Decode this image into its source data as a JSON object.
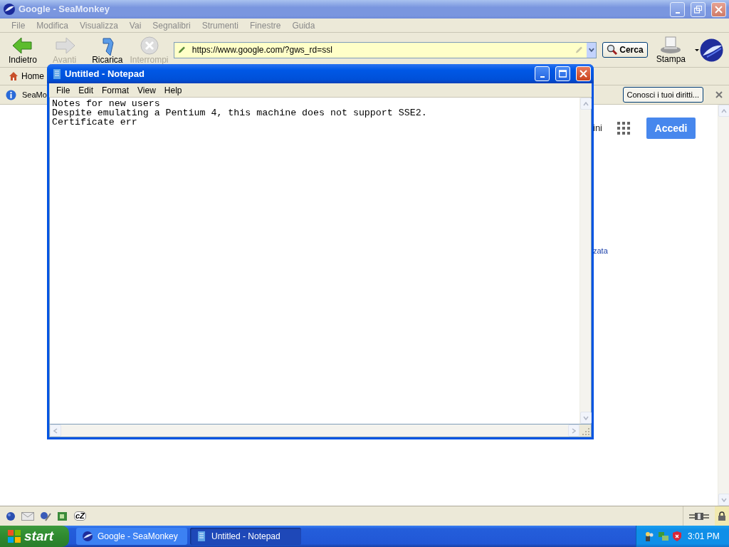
{
  "browser": {
    "title": "Google - SeaMonkey",
    "active": false,
    "menu": [
      "File",
      "Modifica",
      "Visualizza",
      "Vai",
      "Segnalibri",
      "Strumenti",
      "Finestre",
      "Guida"
    ],
    "toolbar": [
      {
        "label": "Indietro",
        "kind": "back",
        "disabled": false
      },
      {
        "label": "Avanti",
        "kind": "forward",
        "disabled": true
      },
      {
        "label": "Ricarica",
        "kind": "reload",
        "disabled": false
      },
      {
        "label": "Interrompi",
        "kind": "stop",
        "disabled": true
      }
    ],
    "address": "https://www.google.com/?gws_rd=ssl",
    "search_button": "Cerca",
    "print_button": "Stampa",
    "bookmarks": [
      "Home"
    ],
    "notification": {
      "text": "SeaMo",
      "button": "Conosci i tuoi diritti..."
    },
    "page": {
      "link_1": "ini",
      "sign_in": "Accedi",
      "link_2": "zata"
    },
    "status_bar": {
      "chat": "cZ"
    }
  },
  "notepad": {
    "title": "Untitled - Notepad",
    "active": true,
    "menu": [
      "File",
      "Edit",
      "Format",
      "View",
      "Help"
    ],
    "lines": [
      "Notes for new users",
      "Despite emulating a Pentium 4, this machine does not support SSE2.",
      "Certificate err"
    ]
  },
  "taskbar": {
    "start": "start",
    "tasks": [
      {
        "label": "Google - SeaMonkey",
        "kind": "browser",
        "selected": false
      },
      {
        "label": "Untitled - Notepad",
        "kind": "notepad",
        "selected": true
      }
    ],
    "clock": "3:01 PM"
  }
}
